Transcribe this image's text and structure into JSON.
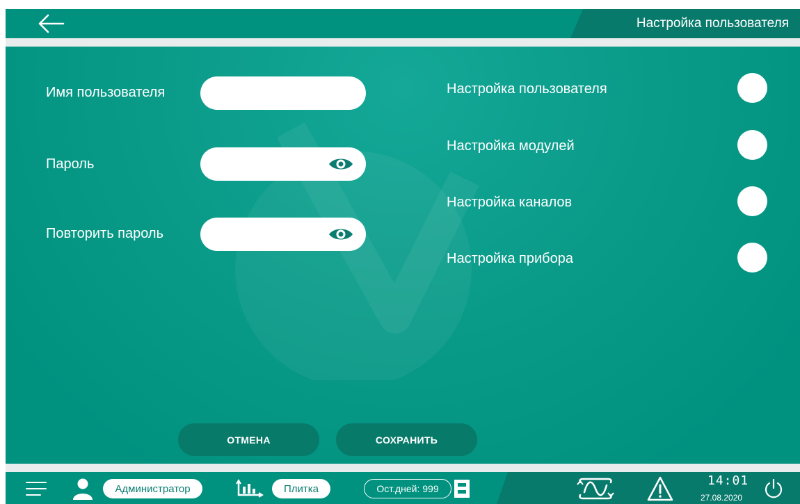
{
  "header": {
    "back_icon": "arrow-left-icon",
    "title": "Настройка пользователя"
  },
  "form": {
    "username": {
      "label": "Имя пользователя",
      "value": ""
    },
    "password": {
      "label": "Пароль",
      "value": "",
      "icon": "eye-icon"
    },
    "repeat_password": {
      "label": "Повторить пароль",
      "value": "",
      "icon": "eye-icon"
    }
  },
  "permissions": [
    {
      "label": "Настройка пользователя"
    },
    {
      "label": "Настройка модулей"
    },
    {
      "label": "Настройка каналов"
    },
    {
      "label": "Настройка прибора"
    }
  ],
  "actions": {
    "cancel_label": "ОТМЕНА",
    "save_label": "СОХРАНИТЬ"
  },
  "statusbar": {
    "menu_icon": "hamburger-menu-icon",
    "user_icon": "user-icon",
    "user_role": "Администратор",
    "chart_icon": "bar-chart-icon",
    "view_mode": "Плитка",
    "days_left": "Ост.дней: 999",
    "storage_icon": "storage-card-icon",
    "signal_icon": "signal-wave-icon",
    "alarm_icon": "warning-triangle-icon",
    "time": "14:01",
    "date": "27.08.2020",
    "power_icon": "power-icon"
  },
  "colors": {
    "primary": "#00917f",
    "dark_accent": "#087a6c",
    "separator": "#e9ecec"
  }
}
